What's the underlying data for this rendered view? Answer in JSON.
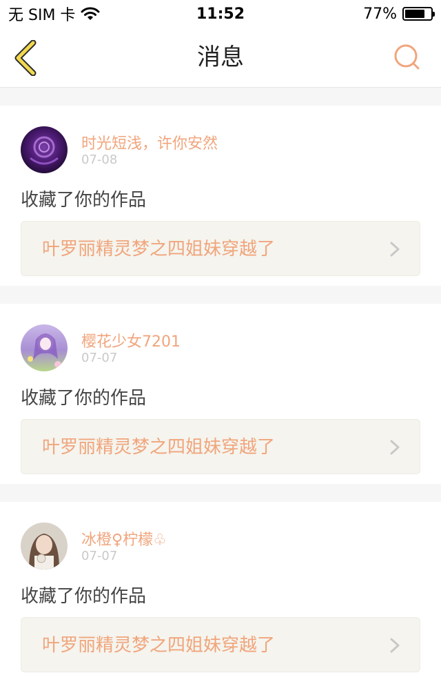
{
  "status_bar": {
    "carrier": "无 SIM 卡",
    "time": "11:52",
    "battery_percent": "77%",
    "battery_level": 0.77
  },
  "nav": {
    "title": "消息",
    "back_icon": "chevron-left-icon",
    "search_icon": "search-icon",
    "accent_color": "#f0a57c",
    "back_color": "#f1d84f"
  },
  "messages": [
    {
      "user": "时光短浅，许你安然",
      "date": "07-08",
      "action": "收藏了你的作品",
      "work_title": "叶罗丽精灵梦之四姐妹穿越了",
      "avatar": "purple-rose-avatar"
    },
    {
      "user": "樱花少女7201",
      "date": "07-07",
      "action": "收藏了你的作品",
      "work_title": "叶罗丽精灵梦之四姐妹穿越了",
      "avatar": "anime-girl-avatar"
    },
    {
      "user": "冰橙♀柠檬♧",
      "date": "07-07",
      "action": "收藏了你的作品",
      "work_title": "叶罗丽精灵梦之四姐妹穿越了",
      "avatar": "photo-girl-avatar"
    }
  ]
}
